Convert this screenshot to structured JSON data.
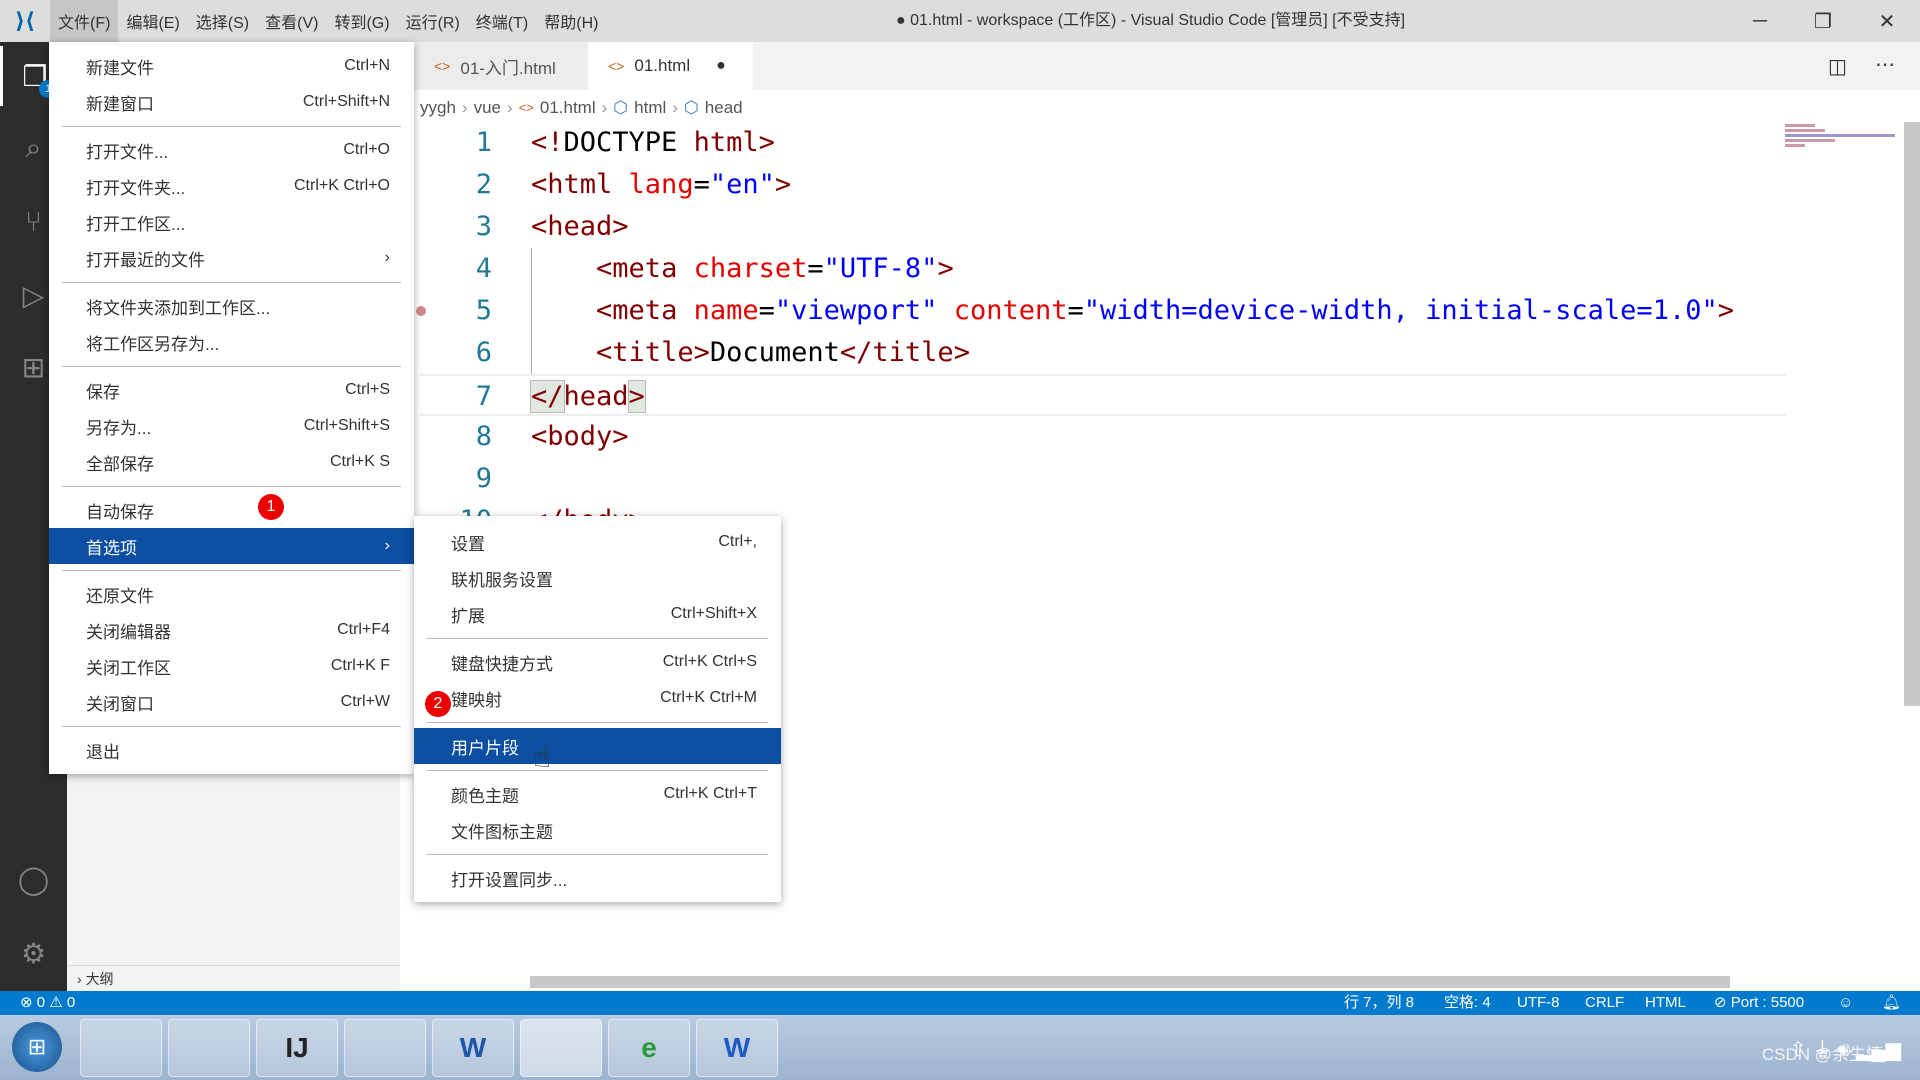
{
  "titlebar": {
    "menus": [
      "文件(F)",
      "编辑(E)",
      "选择(S)",
      "查看(V)",
      "转到(G)",
      "运行(R)",
      "终端(T)",
      "帮助(H)"
    ],
    "title": "● 01.html - workspace (工作区) - Visual Studio Code [管理员] [不受支持]"
  },
  "activity": {
    "explorer_badge": "1"
  },
  "tabs": [
    {
      "label": "01-入门.html"
    },
    {
      "label": "01.html",
      "dirty": "●"
    }
  ],
  "breadcrumb": [
    "yygh",
    "vue",
    "01.html",
    "html",
    "head"
  ],
  "code": [
    [
      [
        "b",
        "<!"
      ],
      [
        "p",
        "DOCTYPE "
      ],
      [
        "t",
        "html"
      ],
      [
        "b",
        ">"
      ]
    ],
    [
      [
        "b",
        "<"
      ],
      [
        "t",
        "html "
      ],
      [
        "a",
        "lang"
      ],
      [
        "p",
        "="
      ],
      [
        "v",
        "\"en\""
      ],
      [
        "b",
        ">"
      ]
    ],
    [
      [
        "b",
        "<"
      ],
      [
        "t",
        "head"
      ],
      [
        "b",
        ">"
      ]
    ],
    [
      [
        "p",
        "    "
      ],
      [
        "b",
        "<"
      ],
      [
        "t",
        "meta "
      ],
      [
        "a",
        "charset"
      ],
      [
        "p",
        "="
      ],
      [
        "v",
        "\"UTF-8\""
      ],
      [
        "b",
        ">"
      ]
    ],
    [
      [
        "p",
        "    "
      ],
      [
        "b",
        "<"
      ],
      [
        "t",
        "meta "
      ],
      [
        "a",
        "name"
      ],
      [
        "p",
        "="
      ],
      [
        "v",
        "\"viewport\" "
      ],
      [
        "a",
        "content"
      ],
      [
        "p",
        "="
      ],
      [
        "v",
        "\"width=device-width, initial-scale=1.0\""
      ],
      [
        "b",
        ">"
      ]
    ],
    [
      [
        "p",
        "    "
      ],
      [
        "b",
        "<"
      ],
      [
        "t",
        "title"
      ],
      [
        "b",
        ">"
      ],
      [
        "p",
        "Document"
      ],
      [
        "b",
        "</"
      ],
      [
        "t",
        "title"
      ],
      [
        "b",
        ">"
      ]
    ],
    [
      [
        "b",
        "</"
      ],
      [
        "t",
        "head"
      ],
      [
        "b",
        ">"
      ]
    ],
    [
      [
        "b",
        "<"
      ],
      [
        "t",
        "body"
      ],
      [
        "b",
        ">"
      ]
    ],
    [],
    [
      [
        "b",
        "</"
      ],
      [
        "t",
        "body"
      ],
      [
        "b",
        ">"
      ]
    ]
  ],
  "file_menu": [
    {
      "label": "新建文件",
      "shortcut": "Ctrl+N"
    },
    {
      "label": "新建窗口",
      "shortcut": "Ctrl+Shift+N"
    },
    {
      "sep": true
    },
    {
      "label": "打开文件...",
      "shortcut": "Ctrl+O"
    },
    {
      "label": "打开文件夹...",
      "shortcut": "Ctrl+K Ctrl+O"
    },
    {
      "label": "打开工作区..."
    },
    {
      "label": "打开最近的文件",
      "submenu": "›"
    },
    {
      "sep": true
    },
    {
      "label": "将文件夹添加到工作区..."
    },
    {
      "label": "将工作区另存为..."
    },
    {
      "sep": true
    },
    {
      "label": "保存",
      "shortcut": "Ctrl+S"
    },
    {
      "label": "另存为...",
      "shortcut": "Ctrl+Shift+S"
    },
    {
      "label": "全部保存",
      "shortcut": "Ctrl+K S"
    },
    {
      "sep": true
    },
    {
      "label": "自动保存"
    },
    {
      "label": "首选项",
      "submenu": "›",
      "highlight": true
    },
    {
      "sep": true
    },
    {
      "label": "还原文件"
    },
    {
      "label": "关闭编辑器",
      "shortcut": "Ctrl+F4"
    },
    {
      "label": "关闭工作区",
      "shortcut": "Ctrl+K F"
    },
    {
      "label": "关闭窗口",
      "shortcut": "Ctrl+W"
    },
    {
      "sep": true
    },
    {
      "label": "退出"
    }
  ],
  "pref_menu": [
    {
      "label": "设置",
      "shortcut": "Ctrl+,"
    },
    {
      "label": "联机服务设置"
    },
    {
      "label": "扩展",
      "shortcut": "Ctrl+Shift+X"
    },
    {
      "sep": true
    },
    {
      "label": "键盘快捷方式",
      "shortcut": "Ctrl+K Ctrl+S"
    },
    {
      "label": "键映射",
      "shortcut": "Ctrl+K Ctrl+M"
    },
    {
      "sep": true
    },
    {
      "label": "用户片段",
      "highlight": true
    },
    {
      "sep": true
    },
    {
      "label": "颜色主题",
      "shortcut": "Ctrl+K Ctrl+T"
    },
    {
      "label": "文件图标主题"
    },
    {
      "sep": true
    },
    {
      "label": "打开设置同步..."
    }
  ],
  "steps": {
    "one": "1",
    "two": "2"
  },
  "sidebar": {
    "outline": "大纲"
  },
  "status": {
    "problems": "⊗ 0 ⚠ 0",
    "position": "行 7，列 8",
    "spaces": "空格: 4",
    "encoding": "UTF-8",
    "eol": "CRLF",
    "language": "HTML",
    "port": "⊘ Port : 5500"
  },
  "taskbar": {
    "icons": [
      "dolphin",
      "file-explorer",
      "intellij",
      "paint",
      "word-doc",
      "vscode",
      "browser",
      "word"
    ],
    "labels": [
      "",
      "",
      "IJ",
      "",
      "W",
      "",
      "e",
      "W"
    ]
  },
  "watermark": "CSDN @余生情晨",
  "colors": {
    "accent": "#007acc",
    "menu_highlight": "#0b4ea2",
    "tag": "#800000",
    "attr": "#e50000",
    "string": "#0000ff"
  }
}
